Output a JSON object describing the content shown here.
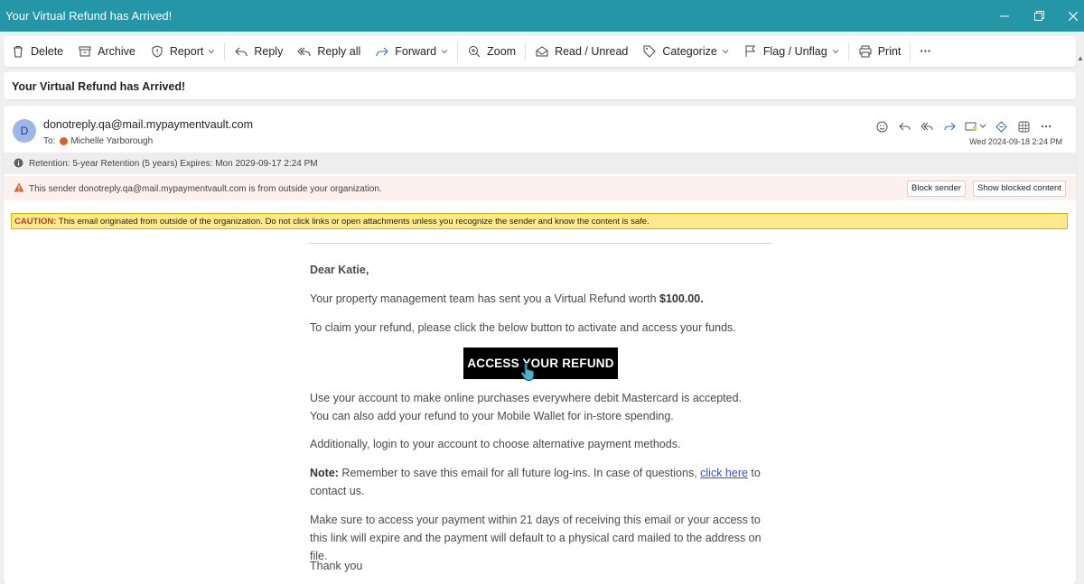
{
  "window": {
    "title": "Your Virtual Refund has Arrived!"
  },
  "toolbar": {
    "delete": "Delete",
    "archive": "Archive",
    "report": "Report",
    "reply": "Reply",
    "reply_all": "Reply all",
    "forward": "Forward",
    "zoom": "Zoom",
    "read_unread": "Read / Unread",
    "categorize": "Categorize",
    "flag_unflag": "Flag / Unflag",
    "print": "Print",
    "more": "···"
  },
  "subject": "Your Virtual Refund has Arrived!",
  "message": {
    "avatar_letter": "D",
    "sender": "donotreply.qa@mail.mypaymentvault.com",
    "to_label": "To:",
    "recipient": "Michelle Yarborough",
    "date": "Wed 2024-09-18 2:24 PM",
    "retention": "Retention: 5-year Retention (5 years) Expires: Mon 2029-09-17 2:24 PM",
    "external_warning": "This sender donotreply.qa@mail.mypaymentvault.com is from outside your organization.",
    "block_sender": "Block sender",
    "show_blocked": "Show blocked content",
    "caution_label": "CAUTION:",
    "caution_text": " This email originated from outside of the organization. Do not click links or open attachments unless you recognize the sender and know the content is safe."
  },
  "email_body": {
    "greeting": "Dear Katie,",
    "p1": "Your property management team has sent you a Virtual Refund worth ",
    "p1_amount": "$100.00.",
    "p2": "To claim your refund, please click the below button to activate and access your funds.",
    "cta": "ACCESS YOUR REFUND",
    "p3": "Use your account to make online purchases everywhere debit Mastercard is accepted. You can also add your refund to your Mobile Wallet for in-store spending.",
    "p4": "Additionally, login to your account to choose alternative payment methods.",
    "note_label": "Note:",
    "note_text": " Remember to save this email for all future log-ins. In case of questions, ",
    "note_link": "click here",
    "note_tail": " to contact us.",
    "p6": "Make sure to access your payment within 21 days of receiving this email or your access to this link will expire and the payment will default to a physical card mailed to the address on file.",
    "closing": "Thank you"
  }
}
